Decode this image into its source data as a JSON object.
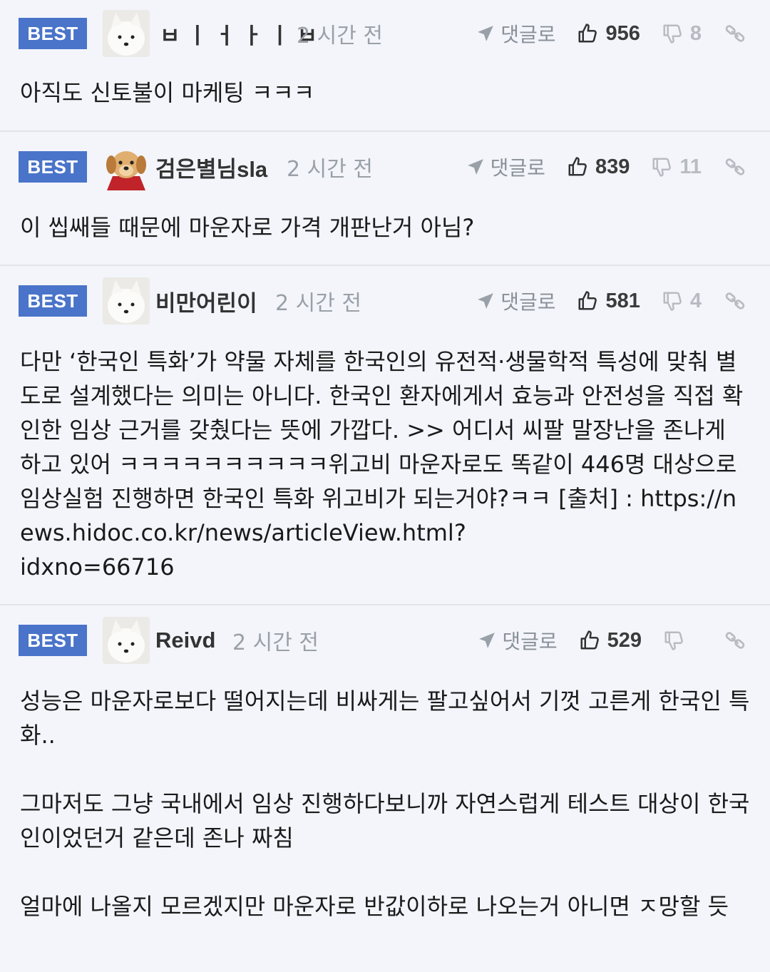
{
  "badge_label": "BEST",
  "reply_label": "댓글로",
  "comments": [
    {
      "author": "ㅂㅣㅓㅏㅣㅂ",
      "time": "2 시간 전",
      "likes": "956",
      "dislikes": "8",
      "avatar": "white-dog-avatar",
      "text": "아직도 신토불이 마케팅 ㅋㅋㅋ"
    },
    {
      "author": "검은별님sla",
      "time": "2 시간 전",
      "likes": "839",
      "dislikes": "11",
      "avatar": "puppy-avatar",
      "text": "이 씹쌔들 때문에 마운자로 가격 개판난거 아님?"
    },
    {
      "author": "비만어린이",
      "time": "2 시간 전",
      "likes": "581",
      "dislikes": "4",
      "avatar": "white-dog-avatar",
      "text": "다만 ‘한국인 특화’가 약물 자체를 한국인의 유전적·생물학적 특성에 맞춰 별도로 설계했다는 의미는 아니다. 한국인 환자에게서 효능과 안전성을 직접 확인한 임상 근거를 갖췄다는 뜻에 가깝다. >> 어디서 씨팔 말장난을 존나게 하고 있어 ㅋㅋㅋㅋㅋㅋㅋㅋㅋㅋ위고비 마운자로도 똑같이 446명 대상으로 임상실험 진행하면 한국인 특화 위고비가 되는거야?ㅋㅋ [출처] : https://news.hidoc.co.kr/news/articleView.html?\nidxno=66716"
    },
    {
      "author": "Reivd",
      "time": "2 시간 전",
      "likes": "529",
      "dislikes": "",
      "avatar": "white-dog-avatar",
      "text": "성능은 마운자로보다 떨어지는데 비싸게는 팔고싶어서 기껏 고른게 한국인 특화..\n\n그마저도 그냥 국내에서 임상 진행하다보니까 자연스럽게 테스트 대상이 한국인이었던거 같은데 존나 짜침\n\n얼마에 나올지 모르겠지만 마운자로 반값이하로 나오는거 아니면 ㅈ망할 듯"
    }
  ]
}
